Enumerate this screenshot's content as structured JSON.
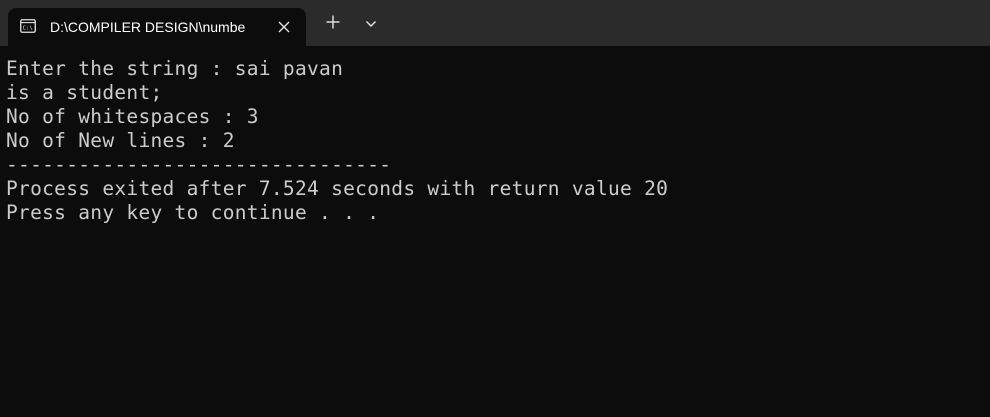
{
  "tab": {
    "title": "D:\\COMPILER DESIGN\\numbe",
    "icon": "terminal-icon"
  },
  "tabbar": {
    "close_icon": "close-icon",
    "new_tab_icon": "plus-icon",
    "dropdown_icon": "chevron-down-icon"
  },
  "console": {
    "lines": [
      "Enter the string : sai pavan",
      "is a student;",
      "No of whitespaces : 3",
      "No of New lines : 2",
      "--------------------------------",
      "Process exited after 7.524 seconds with return value 20",
      "Press any key to continue . . ."
    ]
  },
  "colors": {
    "tabbar_bg": "#2b2b2b",
    "console_bg": "#0c0c0c",
    "console_text": "#cccccc",
    "tab_title": "#ffffff"
  }
}
